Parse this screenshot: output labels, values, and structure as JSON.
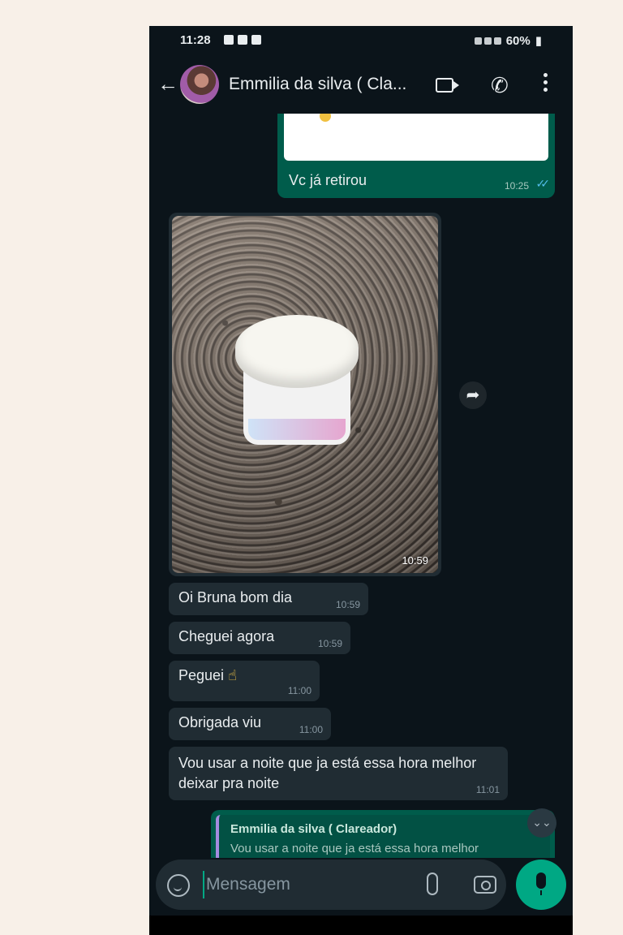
{
  "status_bar": {
    "time": "11:28",
    "battery": "60%"
  },
  "header": {
    "contact_name": "Emmilia da silva ( Cla..."
  },
  "messages": {
    "outgoing_top": {
      "text": "Vc já retirou",
      "time": "10:25"
    },
    "photo": {
      "time": "10:59"
    },
    "incoming": [
      {
        "text": "Oi Bruna bom dia",
        "time": "10:59"
      },
      {
        "text": "Cheguei agora",
        "time": "10:59"
      },
      {
        "text": "Peguei",
        "emoji": "☝",
        "time": "11:00"
      },
      {
        "text": "Obrigada viu",
        "time": "11:00"
      },
      {
        "text": "Vou usar a noite que ja está essa hora melhor deixar pra noite",
        "time": "11:01"
      }
    ],
    "reply": {
      "quoted_name": "Emmilia da silva ( Clareador)",
      "quoted_text": "Vou usar a noite que ja está essa hora melhor"
    }
  },
  "composer": {
    "placeholder": "Mensagem"
  },
  "colors": {
    "background": "#0b141a",
    "outgoing_bubble": "#005c4b",
    "incoming_bubble": "#202c33",
    "accent": "#00a884",
    "read_ticks": "#53bdeb"
  }
}
